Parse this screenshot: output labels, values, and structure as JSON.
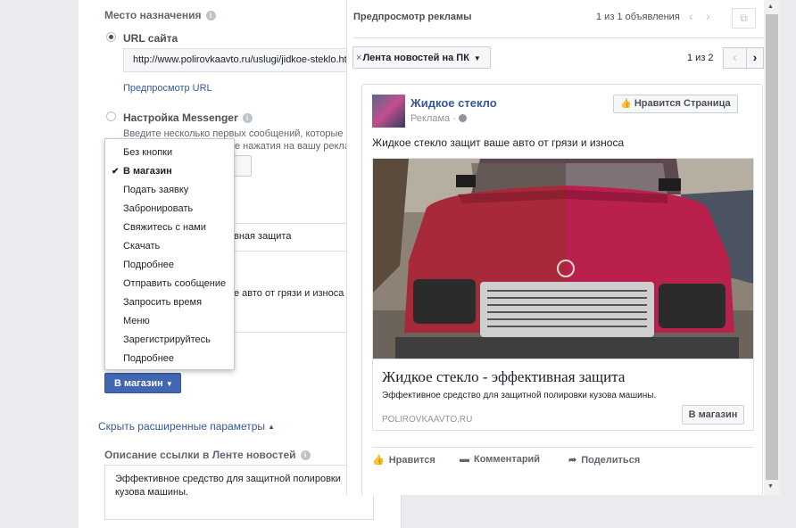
{
  "destination": {
    "title": "Место назначения",
    "url_option": "URL сайта",
    "url_value": "http://www.polirovkaavto.ru/uslugi/jidkoe-steklo.html",
    "preview_url": "Предпросмотр URL",
    "messenger_option": "Настройка Messenger",
    "messenger_hint_1": "Введите несколько первых сообщений, которые л",
    "messenger_hint_2": "е нажатия на вашу рекла",
    "partial_button": "ия",
    "frag_headline": "вная защита",
    "frag_text": "е авто от грязи и износа"
  },
  "cta_dropdown": {
    "items": [
      {
        "label": "Без кнопки",
        "selected": false
      },
      {
        "label": "В магазин",
        "selected": true
      },
      {
        "label": "Подать заявку",
        "selected": false
      },
      {
        "label": "Забронировать",
        "selected": false
      },
      {
        "label": "Свяжитесь с нами",
        "selected": false
      },
      {
        "label": "Скачать",
        "selected": false
      },
      {
        "label": "Подробнее",
        "selected": false
      },
      {
        "label": "Отправить сообщение",
        "selected": false
      },
      {
        "label": "Запросить время",
        "selected": false
      },
      {
        "label": "Меню",
        "selected": false
      },
      {
        "label": "Зарегистрируйтесь",
        "selected": false
      },
      {
        "label": "Подробнее",
        "selected": false
      }
    ],
    "button_label": "В магазин"
  },
  "advanced": {
    "toggle": "Скрыть расширенные параметры",
    "link_desc_title": "Описание ссылки в Ленте новостей",
    "link_desc_value": "Эффективное средство для защитной полировки кузова машины."
  },
  "preview": {
    "title": "Предпросмотр рекламы",
    "count": "1 из 1 объявления",
    "placement": "Лента новостей на ПК",
    "page_count": "1 из 2"
  },
  "ad": {
    "page_name": "Жидкое стекло",
    "sponsored": "Реклама ·",
    "like_page": "Нравится Страница",
    "text": "Жидкое стекло защит ваше авто от грязи и износа",
    "headline": "Жидкое стекло - эффективная защита",
    "description": "Эффективное средство для защитной полировки кузова машины.",
    "domain": "POLIROVKAAVTO.RU",
    "cta": "В магазин",
    "actions": {
      "like": "Нравится",
      "comment": "Комментарий",
      "share": "Поделиться"
    }
  },
  "colors": {
    "accent": "#4267b2",
    "link": "#365899",
    "car_left": "#a52a3a",
    "car_right": "#b81f4c"
  }
}
